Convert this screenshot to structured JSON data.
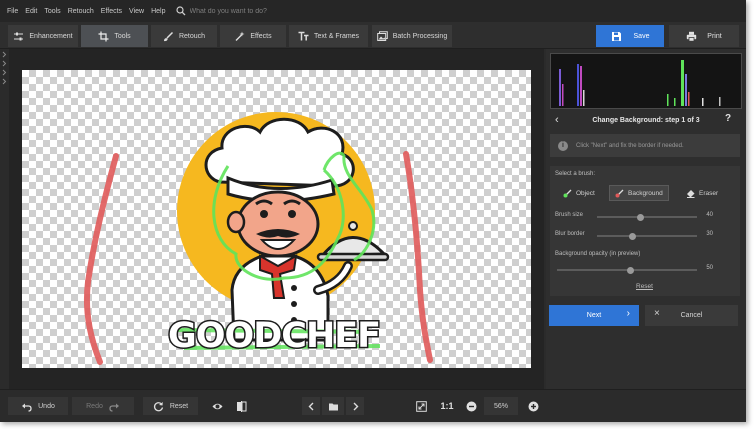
{
  "menu": {
    "items": [
      "File",
      "Edit",
      "Tools",
      "Retouch",
      "Effects",
      "View",
      "Help"
    ],
    "search_placeholder": "What do you want to do?"
  },
  "toolbar": {
    "tabs": [
      {
        "label": "Enhancement",
        "icon": "sliders-icon"
      },
      {
        "label": "Tools",
        "icon": "crop-icon",
        "active": true
      },
      {
        "label": "Retouch",
        "icon": "brush-icon"
      },
      {
        "label": "Effects",
        "icon": "magic-wand-icon"
      },
      {
        "label": "Text & Frames",
        "icon": "text-icon"
      },
      {
        "label": "Batch Processing",
        "icon": "images-icon"
      }
    ],
    "save_label": "Save",
    "print_label": "Print"
  },
  "canvas": {
    "logo_text": "GOODCHEF"
  },
  "bottom": {
    "undo_label": "Undo",
    "redo_label": "Redo",
    "reset_label": "Reset",
    "ratio_label": "1:1",
    "zoom_value": "56%"
  },
  "panel": {
    "title": "Change Background: step 1 of 3",
    "hint": "Click \"Next\" and fix the border if needed.",
    "brush_title": "Select a brush:",
    "brushes": [
      "Object",
      "Background",
      "Eraser"
    ],
    "active_brush": "Background",
    "brush_size_label": "Brush size",
    "brush_size_value": "40",
    "blur_border_label": "Blur border",
    "blur_border_value": "30",
    "bg_opacity_label": "Background opacity (in preview)",
    "bg_opacity_value": "50",
    "reset_label": "Reset",
    "next_label": "Next",
    "cancel_label": "Cancel"
  },
  "colors": {
    "accent": "#2f75d6",
    "object_stroke": "#5fe35a",
    "background_stroke": "#e05a5a"
  }
}
